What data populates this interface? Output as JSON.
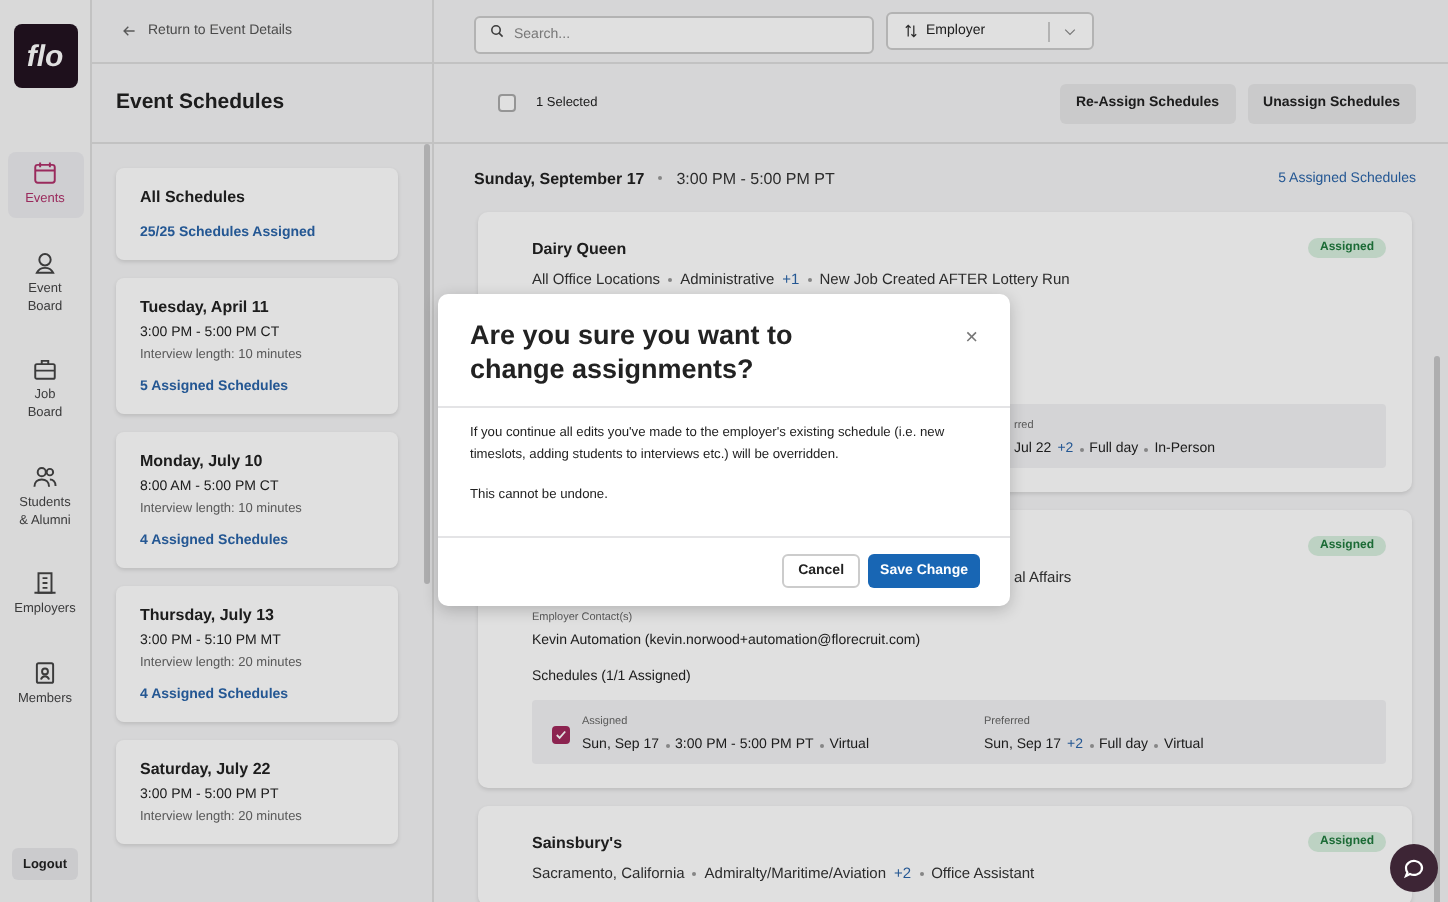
{
  "nav": {
    "logo": "flo",
    "logout": "Logout",
    "items": [
      {
        "lines": [
          "Events"
        ],
        "selected": true
      },
      {
        "lines": [
          "Event",
          "Board"
        ],
        "selected": false
      },
      {
        "lines": [
          "Job",
          "Board"
        ],
        "selected": false
      },
      {
        "lines": [
          "Students",
          "& Alumni"
        ],
        "selected": false
      },
      {
        "lines": [
          "Employers"
        ],
        "selected": false
      },
      {
        "lines": [
          "Members"
        ],
        "selected": false
      }
    ]
  },
  "back_link": "Return to Event Details",
  "panel_title": "Event Schedules",
  "schedules": [
    {
      "title": "All Schedules",
      "link": "25/25 Schedules Assigned"
    },
    {
      "title": "Tuesday, April 11",
      "time": "3:00 PM - 5:00 PM CT",
      "length": "Interview length: 10 minutes",
      "link": "5 Assigned Schedules"
    },
    {
      "title": "Monday, July 10",
      "time": "8:00 AM - 5:00 PM CT",
      "length": "Interview length: 10 minutes",
      "link": "4 Assigned Schedules"
    },
    {
      "title": "Thursday, July 13",
      "time": "3:00 PM - 5:10 PM MT",
      "length": "Interview length: 20 minutes",
      "link": "4 Assigned Schedules"
    },
    {
      "title": "Saturday, July 22",
      "time": "3:00 PM - 5:00 PM PT",
      "length": "Interview length: 20 minutes"
    }
  ],
  "search": {
    "placeholder": "Search..."
  },
  "sort": {
    "label": "Employer"
  },
  "selection": {
    "checked": false,
    "label": "1 Selected"
  },
  "actions": [
    "Re-Assign Schedules",
    "Unassign Schedules"
  ],
  "date_header": {
    "date": "Sunday, September 17",
    "time": "3:00 PM - 5:00 PM PT",
    "link": "5 Assigned Schedules"
  },
  "employers": [
    {
      "name": "Dairy Queen",
      "status": "Assigned",
      "details": [
        {
          "text": "All Office Locations"
        },
        {
          "text": "Administrative",
          "more": "+1"
        },
        {
          "text": "New Job Created AFTER Lottery Run"
        }
      ],
      "schedule": {
        "preferred_label": "rred",
        "preferred": [
          {
            "text": "Jul 22",
            "more": "+2"
          },
          {
            "text": "Full day"
          },
          {
            "text": "In-Person"
          }
        ]
      }
    },
    {
      "status": "Assigned",
      "details": [
        {
          "text": "al Affairs"
        }
      ],
      "contact_label": "Employer Contact(s)",
      "contact": "Kevin Automation (kevin.norwood+automation@florecruit.com)",
      "schedules_label": "Schedules (1/1 Assigned)",
      "schedule": {
        "checked": true,
        "assigned_label": "Assigned",
        "assigned": [
          {
            "text": "Sun, Sep 17"
          },
          {
            "text": "3:00 PM - 5:00 PM PT"
          },
          {
            "text": "Virtual"
          }
        ],
        "preferred_label": "Preferred",
        "preferred": [
          {
            "text": "Sun, Sep 17",
            "more": "+2"
          },
          {
            "text": "Full day"
          },
          {
            "text": "Virtual"
          }
        ]
      }
    },
    {
      "name": "Sainsbury's",
      "status": "Assigned",
      "details": [
        {
          "text": "Sacramento, California"
        },
        {
          "text": "Admiralty/Maritime/Aviation",
          "more": "+2"
        },
        {
          "text": "Office Assistant"
        }
      ]
    }
  ],
  "modal": {
    "title": "Are you sure you want to change assignments?",
    "close": "×",
    "paragraphs": [
      "If you continue all edits you've made to the employer's existing schedule (i.e. new timeslots, adding students to interviews etc.) will be overridden.",
      "This cannot be undone."
    ],
    "cancel": "Cancel",
    "confirm": "Save Change"
  }
}
